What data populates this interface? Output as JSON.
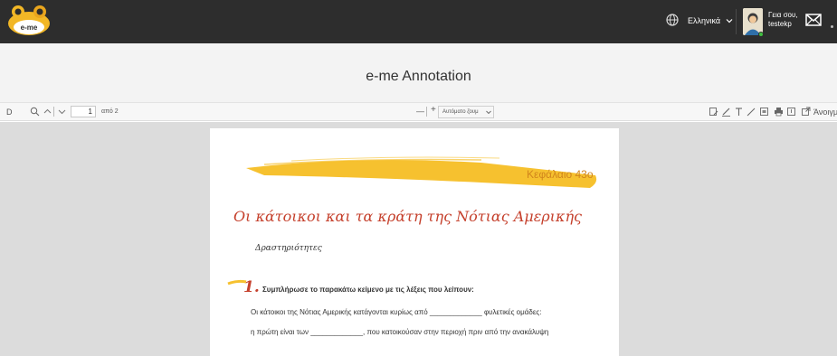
{
  "header": {
    "logo_text": "e-me",
    "language": "Ελληνικά",
    "greeting_line1": "Γεια σου,",
    "greeting_line2": "testekp"
  },
  "app": {
    "title": "e-me Annotation"
  },
  "toolbar": {
    "sidebar_toggle": "D",
    "page_current": "1",
    "page_of": "από 2",
    "zoom_minus": "—",
    "zoom_plus": "+",
    "zoom_value": "Αυτόματο ζουμ",
    "open_label": "Άνοιγμ"
  },
  "document": {
    "chapter": "Κεφάλαιο 43ο",
    "title": "Οι κάτοικοι και τα κράτη της Νότιας Αμερικής",
    "section": "Δραστηριότητες",
    "exercise_number": "1.",
    "instruction": "Συμπλήρωσε το παρακάτω κείμενο με τις λέξεις που λείπουν:",
    "line1": "Οι κάτοικοι της Νότιας Αμερικής κατάγονται κυρίως από _____________ φυλετικές ομάδες:",
    "line2": "η πρώτη είναι των _____________, που κατοικούσαν στην περιοχή πριν από την ανακάλυψη"
  },
  "colors": {
    "topbar": "#2d2d2d",
    "accent": "#f2b726",
    "title_red": "#c5402c",
    "chapter_orange": "#d1851c"
  }
}
